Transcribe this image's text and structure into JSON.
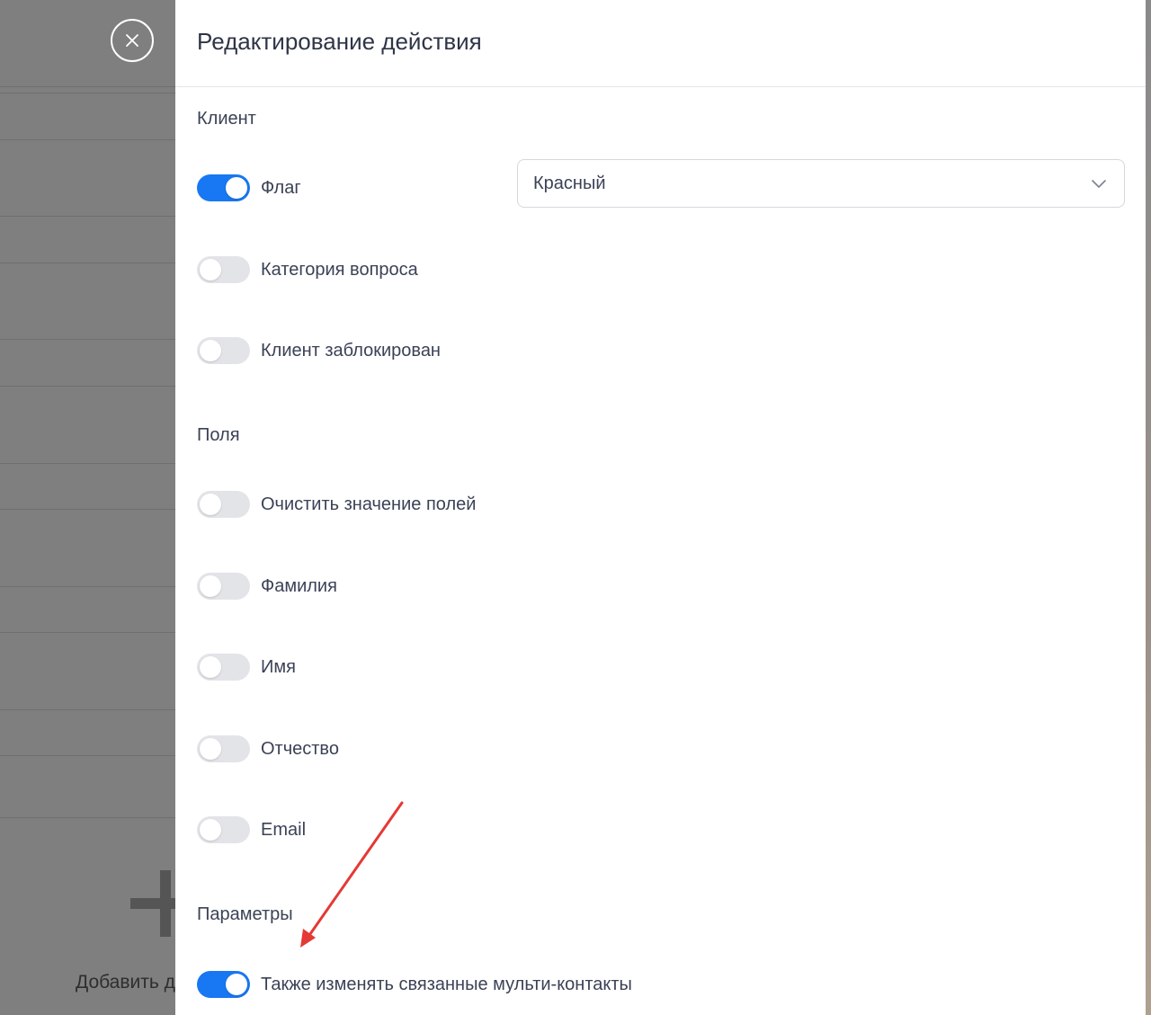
{
  "background": {
    "add_label": "Добавить действие",
    "plus_icon": "plus-icon"
  },
  "close_icon": "close-icon",
  "panel": {
    "title": "Редактирование действия",
    "sections": {
      "client": {
        "title": "Клиент",
        "items": [
          {
            "label": "Флаг",
            "on": true
          },
          {
            "label": "Категория вопроса",
            "on": false
          },
          {
            "label": "Клиент заблокирован",
            "on": false
          }
        ],
        "flag_select": {
          "value": "Красный",
          "icon": "chevron-down-icon"
        }
      },
      "fields": {
        "title": "Поля",
        "items": [
          {
            "label": "Очистить значение полей",
            "on": false
          },
          {
            "label": "Фамилия",
            "on": false
          },
          {
            "label": "Имя",
            "on": false
          },
          {
            "label": "Отчество",
            "on": false
          },
          {
            "label": "Email",
            "on": false
          }
        ]
      },
      "params": {
        "title": "Параметры",
        "items": [
          {
            "label": "Также изменять связанные мульти-контакты",
            "on": true
          }
        ]
      }
    }
  },
  "colors": {
    "accent": "#1877f2",
    "toggle_off": "#e2e4e8",
    "annotation_arrow": "#e53935",
    "overlay": "#7f7f7f"
  }
}
